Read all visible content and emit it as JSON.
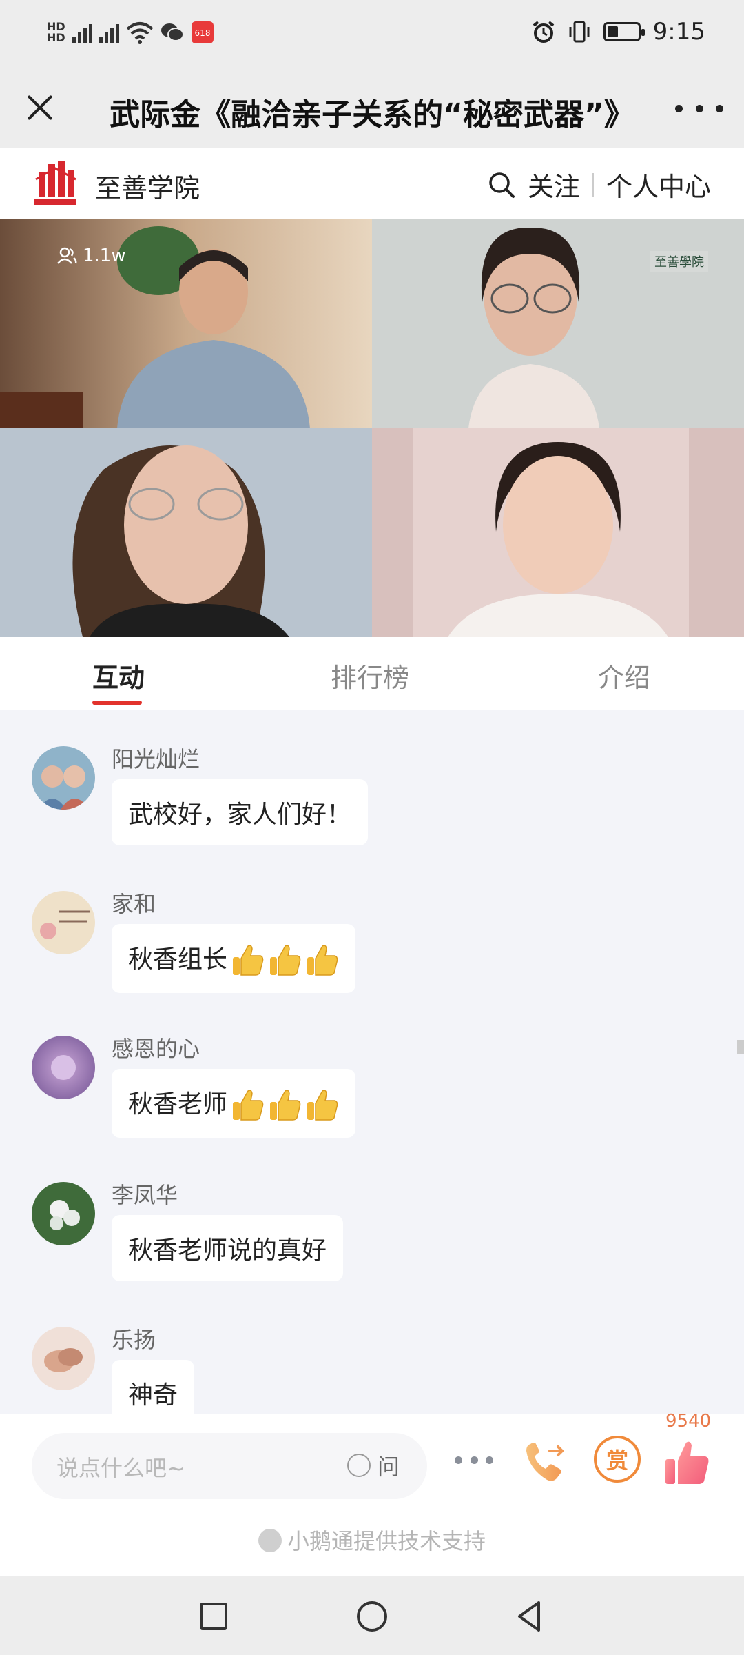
{
  "status_bar": {
    "network_left": "HD 5G 4G",
    "time": "9:15",
    "battery_level": 0.35
  },
  "header": {
    "title": "武际金《融洽亲子关系的“秘密武器”》"
  },
  "brand": {
    "name": "至善学院",
    "follow_label": "关注",
    "profile_label": "个人中心"
  },
  "video": {
    "viewer_count": "1.1w",
    "watermark": "至善學院"
  },
  "tabs": [
    {
      "label": "互动",
      "active": true
    },
    {
      "label": "排行榜",
      "active": false
    },
    {
      "label": "介绍",
      "active": false
    }
  ],
  "messages": [
    {
      "name": "阳光灿烂",
      "text": "武校好，家人们好！",
      "thumbs": 0
    },
    {
      "name": "家和",
      "text": "秋香组长",
      "thumbs": 3
    },
    {
      "name": "感恩的心",
      "text": "秋香老师",
      "thumbs": 3
    },
    {
      "name": "李凤华",
      "text": "秋香老师说的真好",
      "thumbs": 0
    },
    {
      "name": "乐扬",
      "text": "神奇",
      "thumbs": 0
    }
  ],
  "input": {
    "placeholder": "说点什么吧~",
    "ask_label": "问",
    "reward_label": "赏",
    "like_count": "9540"
  },
  "footer": {
    "powered_by": "小鹅通提供技术支持"
  },
  "colors": {
    "accent_red": "#e2322c",
    "reward_orange": "#f08a3a",
    "like_count": "#e8794a"
  }
}
